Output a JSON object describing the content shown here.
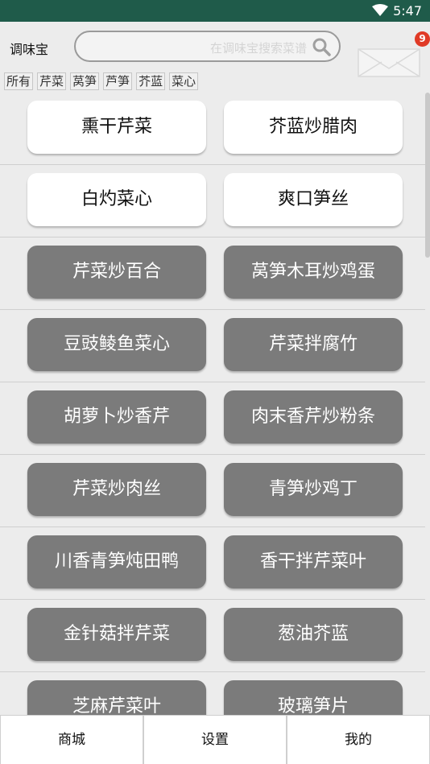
{
  "status_bar": {
    "time": "5:47",
    "wifi_icon": "wifi-icon"
  },
  "header": {
    "app_title": "调味宝",
    "search_placeholder": "在调味宝搜索菜谱",
    "search_icon": "search-icon",
    "mail_icon": "envelope-icon",
    "mail_badge": "9"
  },
  "chips": [
    "所有",
    "芹菜",
    "莴笋",
    "芦笋",
    "芥蓝",
    "菜心"
  ],
  "rows": [
    [
      "熏干芹菜",
      "芥蓝炒腊肉"
    ],
    [
      "白灼菜心",
      "爽口笋丝"
    ],
    [
      "芹菜炒百合",
      "莴笋木耳炒鸡蛋"
    ],
    [
      "豆豉鲮鱼菜心",
      "芹菜拌腐竹"
    ],
    [
      "胡萝卜炒香芹",
      "肉末香芹炒粉条"
    ],
    [
      "芹菜炒肉丝",
      "青笋炒鸡丁"
    ],
    [
      "川香青笋炖田鸭",
      "香干拌芹菜叶"
    ],
    [
      "金针菇拌芹菜",
      "葱油芥蓝"
    ],
    [
      "芝麻芹菜叶",
      "玻璃笋片"
    ]
  ],
  "bottom_nav": {
    "shop": "商城",
    "settings": "设置",
    "mine": "我的"
  },
  "colors": {
    "status_bar": "#1f5b4a",
    "card_gray": "#7b7b7b",
    "card_white": "#ffffff",
    "badge": "#e03a26"
  }
}
